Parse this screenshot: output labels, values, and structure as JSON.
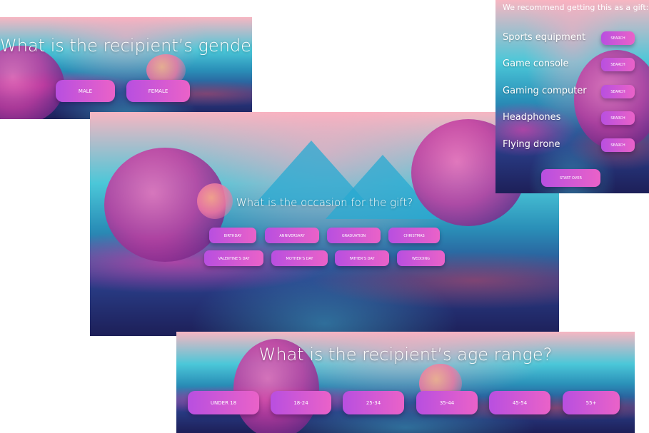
{
  "gender_panel": {
    "question": "What is the recipient’s gender?",
    "options": [
      "MALE",
      "FEMALE"
    ]
  },
  "occasion_panel": {
    "question": "What is the occasion for the gift?",
    "options_row1": [
      "BIRTHDAY",
      "ANNIVERSARY",
      "GRADUATION",
      "CHRISTMAS"
    ],
    "options_row2": [
      "VALENTINE’S DAY",
      "MOTHER’S DAY",
      "FATHER’S DAY",
      "WEDDING"
    ]
  },
  "recommendation_panel": {
    "heading": "We recommend getting this as a gift:",
    "items": [
      "Sports equipment",
      "Game console",
      "Gaming computer",
      "Headphones",
      "Flying drone"
    ],
    "search_label": "SEARCH",
    "start_over_label": "START OVER"
  },
  "age_panel": {
    "question": "What is the recipient’s age range?",
    "options": [
      "UNDER 18",
      "18-24",
      "25-34",
      "35-44",
      "45-54",
      "55+"
    ]
  },
  "colors": {
    "button_start": "#b84fe0",
    "button_end": "#ea62c8",
    "text": "#ffffff"
  }
}
